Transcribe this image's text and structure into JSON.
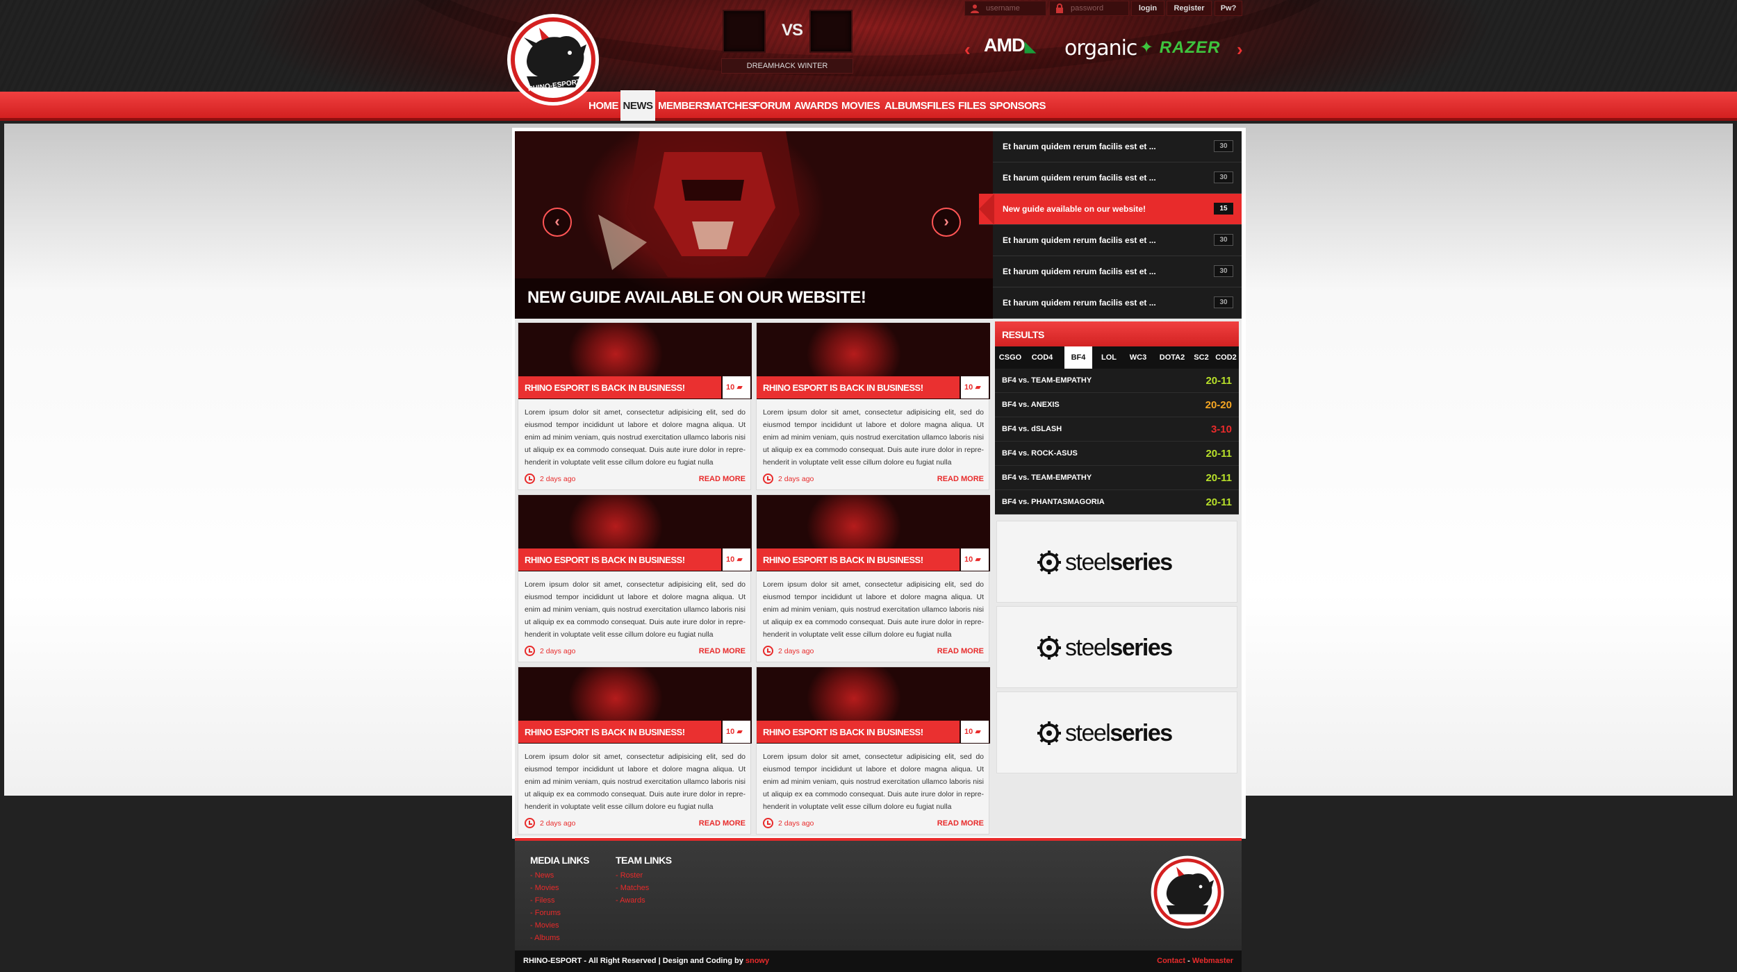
{
  "brand": {
    "logo_text": "RHINO-ESPORT"
  },
  "match": {
    "vs_label": "VS",
    "event_name": "DREAMHACK WINTER"
  },
  "login": {
    "username_placeholder": "username",
    "password_placeholder": "password",
    "login_label": "login",
    "register_label": "Register",
    "forgot_label": "Pw?"
  },
  "sponsors_header": {
    "prev": "‹",
    "next": "›",
    "items": [
      "AMD",
      "organic",
      "RAZER"
    ]
  },
  "nav": {
    "items": [
      "HOME",
      "NEWS",
      "MEMBERS",
      "MATCHES",
      "FORUM",
      "AWARDS",
      "MOVIES",
      "ALBUMS",
      "FILES",
      "FILES",
      "SPONSORS"
    ],
    "active": "NEWS"
  },
  "slider": {
    "caption": "NEW GUIDE AVAILABLE ON OUR WEBSITE!",
    "prev": "‹",
    "next": "›",
    "items": [
      {
        "title": "Et harum quidem rerum facilis est et ...",
        "count": "30"
      },
      {
        "title": "Et harum quidem rerum facilis est et ...",
        "count": "30"
      },
      {
        "title": "New guide available on our website!",
        "count": "15"
      },
      {
        "title": "Et harum quidem rerum facilis est et ...",
        "count": "30"
      },
      {
        "title": "Et harum quidem rerum facilis est et ...",
        "count": "30"
      },
      {
        "title": "Et harum quidem rerum facilis est et ...",
        "count": "30"
      }
    ]
  },
  "news": {
    "cards": [
      {
        "title": "RHINO ESPORT IS BACK IN BUSINESS!",
        "comments": "10",
        "text": "Lorem ipsum dolor sit amet, consectetur adipisicing elit, sed do eiusmod tempor incididunt ut labore et dolore magna aliqua. Ut enim ad minim veniam, quis nostrud exercitation ullamco laboris nisi ut aliquip ex ea commodo consequat. Duis aute irure dolor in repre- henderit in voluptate velit esse cillum dolore eu fugiat nulla",
        "time": "2 days ago",
        "read_more": "READ MORE"
      },
      {
        "title": "RHINO ESPORT IS BACK IN BUSINESS!",
        "comments": "10",
        "text": "Lorem ipsum dolor sit amet, consectetur adipisicing elit, sed do eiusmod tempor incididunt ut labore et dolore magna aliqua. Ut enim ad minim veniam, quis nostrud exercitation ullamco laboris nisi ut aliquip ex ea commodo consequat. Duis aute irure dolor in repre- henderit in voluptate velit esse cillum dolore eu fugiat nulla",
        "time": "2 days ago",
        "read_more": "READ MORE"
      },
      {
        "title": "RHINO ESPORT IS BACK IN BUSINESS!",
        "comments": "10",
        "text": "Lorem ipsum dolor sit amet, consectetur adipisicing elit, sed do eiusmod tempor incididunt ut labore et dolore magna aliqua. Ut enim ad minim veniam, quis nostrud exercitation ullamco laboris nisi ut aliquip ex ea commodo consequat. Duis aute irure dolor in repre- henderit in voluptate velit esse cillum dolore eu fugiat nulla",
        "time": "2 days ago",
        "read_more": "READ MORE"
      },
      {
        "title": "RHINO ESPORT IS BACK IN BUSINESS!",
        "comments": "10",
        "text": "Lorem ipsum dolor sit amet, consectetur adipisicing elit, sed do eiusmod tempor incididunt ut labore et dolore magna aliqua. Ut enim ad minim veniam, quis nostrud exercitation ullamco laboris nisi ut aliquip ex ea commodo consequat. Duis aute irure dolor in repre- henderit in voluptate velit esse cillum dolore eu fugiat nulla",
        "time": "2 days ago",
        "read_more": "READ MORE"
      },
      {
        "title": "RHINO ESPORT IS BACK IN BUSINESS!",
        "comments": "10",
        "text": "Lorem ipsum dolor sit amet, consectetur adipisicing elit, sed do eiusmod tempor incididunt ut labore et dolore magna aliqua. Ut enim ad minim veniam, quis nostrud exercitation ullamco laboris nisi ut aliquip ex ea commodo consequat. Duis aute irure dolor in repre- henderit in voluptate velit esse cillum dolore eu fugiat nulla",
        "time": "2 days ago",
        "read_more": "READ MORE"
      },
      {
        "title": "RHINO ESPORT IS BACK IN BUSINESS!",
        "comments": "10",
        "text": "Lorem ipsum dolor sit amet, consectetur adipisicing elit, sed do eiusmod tempor incididunt ut labore et dolore magna aliqua. Ut enim ad minim veniam, quis nostrud exercitation ullamco laboris nisi ut aliquip ex ea commodo consequat. Duis aute irure dolor in repre- henderit in voluptate velit esse cillum dolore eu fugiat nulla",
        "time": "2 days ago",
        "read_more": "READ MORE"
      }
    ]
  },
  "results": {
    "title": "RESULTS",
    "tabs": [
      "CSGO",
      "COD4",
      "BF4",
      "LOL",
      "WC3",
      "DOTA2",
      "SC2",
      "COD2"
    ],
    "active_tab": "BF4",
    "rows": [
      {
        "match": "BF4 vs. TEAM-EMPATHY",
        "score": "20-11",
        "color": "#b8e02a"
      },
      {
        "match": "BF4 vs. ANEXIS",
        "score": "20-20",
        "color": "#f5a623"
      },
      {
        "match": "BF4 vs. dSLASH",
        "score": "3-10",
        "color": "#e82b2b"
      },
      {
        "match": "BF4 vs. ROCK-ASUS",
        "score": "20-11",
        "color": "#b8e02a"
      },
      {
        "match": "BF4 vs. TEAM-EMPATHY",
        "score": "20-11",
        "color": "#b8e02a"
      },
      {
        "match": "BF4 vs. PHANTASMAGORIA",
        "score": "20-11",
        "color": "#b8e02a"
      }
    ]
  },
  "sidebar_sponsors": [
    {
      "name_light": "steel",
      "name_bold": "series"
    },
    {
      "name_light": "steel",
      "name_bold": "series"
    },
    {
      "name_light": "steel",
      "name_bold": "series"
    }
  ],
  "footer": {
    "media_title": "MEDIA LINKS",
    "media_links": [
      "- News",
      "- Movies",
      "- Filess",
      "- Forums",
      "- Movies",
      "- Albums"
    ],
    "team_title": "TEAM LINKS",
    "team_links": [
      "- Roster",
      "- Matches",
      "- Awards"
    ],
    "copyright_prefix": "RHINO-ESPORT - All Right Reserved | Design and Coding by",
    "author": "snowy",
    "contact": "Contact",
    "separator": "-",
    "webmaster": "Webmaster"
  },
  "colors": {
    "accent": "#e82b2b",
    "dark": "#1c1c1c",
    "win": "#b8e02a",
    "draw": "#f5a623",
    "loss": "#e82b2b"
  }
}
